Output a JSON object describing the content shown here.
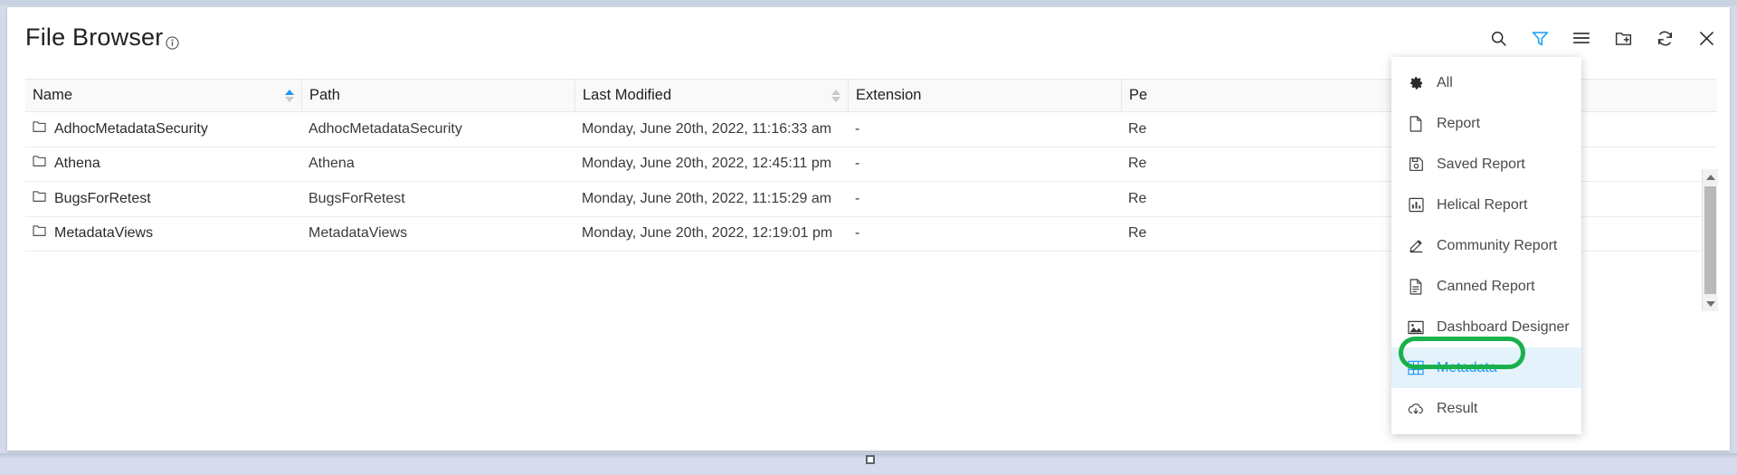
{
  "header": {
    "title": "File Browser",
    "info_icon": "info-icon",
    "toolbar": [
      {
        "name": "search-icon",
        "label": "Search",
        "active": false
      },
      {
        "name": "filter-icon",
        "label": "Filter",
        "active": true
      },
      {
        "name": "menu-icon",
        "label": "Menu",
        "active": false
      },
      {
        "name": "new-folder-icon",
        "label": "New Folder",
        "active": false
      },
      {
        "name": "refresh-icon",
        "label": "Refresh",
        "active": false
      },
      {
        "name": "close-icon",
        "label": "Close",
        "active": false
      }
    ]
  },
  "table": {
    "columns": [
      {
        "label": "Name",
        "sortable": true,
        "sort": "asc"
      },
      {
        "label": "Path",
        "sortable": false,
        "sort": "none"
      },
      {
        "label": "Last Modified",
        "sortable": true,
        "sort": "none"
      },
      {
        "label": "Extension",
        "sortable": false,
        "sort": "none"
      },
      {
        "label": "Pe",
        "sortable": false,
        "sort": "none"
      },
      {
        "label": "",
        "sortable": false,
        "sort": "none"
      }
    ],
    "rows": [
      {
        "icon": "folder-icon",
        "name": "AdhocMetadataSecurity",
        "path": "AdhocMetadataSecurity",
        "last_modified": "Monday, June 20th, 2022, 11:16:33 am",
        "extension": "-",
        "permission": "Re"
      },
      {
        "icon": "folder-icon",
        "name": "Athena",
        "path": "Athena",
        "last_modified": "Monday, June 20th, 2022, 12:45:11 pm",
        "extension": "-",
        "permission": "Re"
      },
      {
        "icon": "folder-icon",
        "name": "BugsForRetest",
        "path": "BugsForRetest",
        "last_modified": "Monday, June 20th, 2022, 11:15:29 am",
        "extension": "-",
        "permission": "Re"
      },
      {
        "icon": "folder-icon",
        "name": "MetadataViews",
        "path": "MetadataViews",
        "last_modified": "Monday, June 20th, 2022, 12:19:01 pm",
        "extension": "-",
        "permission": "Re"
      }
    ]
  },
  "filter_menu": {
    "items": [
      {
        "label": "All",
        "icon": "gear-icon",
        "selected": false
      },
      {
        "label": "Report",
        "icon": "file-icon",
        "selected": false
      },
      {
        "label": "Saved Report",
        "icon": "save-icon",
        "selected": false
      },
      {
        "label": "Helical Report",
        "icon": "bar-chart-icon",
        "selected": false
      },
      {
        "label": "Community Report",
        "icon": "pencil-icon",
        "selected": false
      },
      {
        "label": "Canned Report",
        "icon": "document-icon",
        "selected": false
      },
      {
        "label": "Dashboard Designer",
        "icon": "image-icon",
        "selected": false
      },
      {
        "label": "Metadata",
        "icon": "grid-table-icon",
        "selected": true
      },
      {
        "label": "Result",
        "icon": "cloud-down-icon",
        "selected": false
      }
    ]
  },
  "annotation": {
    "type": "highlight-ellipse",
    "target": "Metadata",
    "color": "#18b14b"
  },
  "colors": {
    "accent": "#2196f3",
    "selected_bg": "#e4f3fb",
    "annotation_green": "#18b14b",
    "page_bg": "#d4dbe8"
  }
}
